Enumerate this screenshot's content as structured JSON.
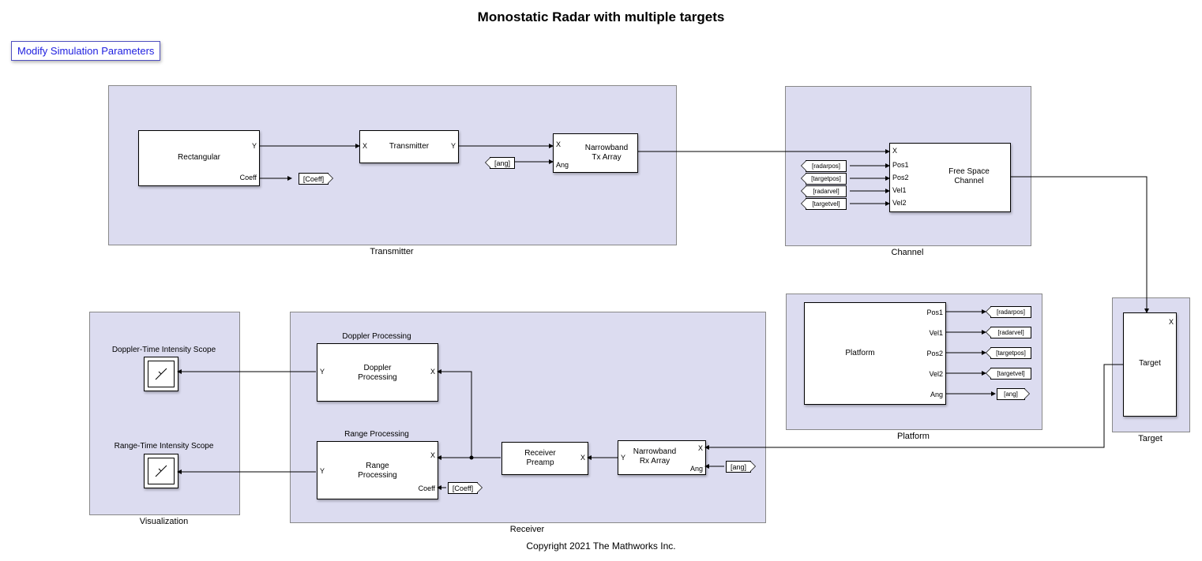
{
  "title": "Monostatic Radar with multiple targets",
  "link": "Modify Simulation Parameters",
  "footer": "Copyright 2021 The Mathworks Inc.",
  "groups": {
    "transmitter": "Transmitter",
    "channel": "Channel",
    "platform": "Platform",
    "target": "Target",
    "receiver": "Receiver",
    "viz": "Visualization"
  },
  "blocks": {
    "rect": {
      "name": "Rectangular",
      "ports_out": [
        "Y",
        "Coeff"
      ]
    },
    "tx": {
      "name": "Transmitter",
      "ports_in": [
        "X"
      ],
      "ports_out": [
        "Y"
      ]
    },
    "txarray": {
      "name": "Narrowband\nTx Array",
      "ports_in": [
        "X",
        "Ang"
      ]
    },
    "fspace": {
      "name": "Free Space\nChannel",
      "ports_in": [
        "X",
        "Pos1",
        "Pos2",
        "Vel1",
        "Vel2"
      ]
    },
    "platform": {
      "name": "Platform",
      "ports_out": [
        "Pos1",
        "Vel1",
        "Pos2",
        "Vel2",
        "Ang"
      ]
    },
    "target": {
      "name": "Target",
      "ports_in": [
        "X"
      ]
    },
    "rxarray": {
      "name": "Narrowband\nRx Array",
      "ports_in_r": [
        "X",
        "Ang"
      ],
      "ports_out": [
        "Y"
      ]
    },
    "preamp": {
      "name": "Receiver\nPreamp",
      "ports_in_r": [
        "X"
      ]
    },
    "range": {
      "name": "Range\nProcessing",
      "label": "Range Processing",
      "ports_in_r": [
        "X",
        "Coeff"
      ],
      "ports_out_l": [
        "Y"
      ]
    },
    "doppler": {
      "name": "Doppler\nProcessing",
      "label": "Doppler Processing",
      "ports_in_r": [
        "X"
      ],
      "ports_out_l": [
        "Y"
      ]
    },
    "scope1": "Doppler-Time Intensity Scope",
    "scope2": "Range-Time Intensity Scope"
  },
  "tags": {
    "coeff": "[Coeff]",
    "ang": "[ang]",
    "radarpos": "[radarpos]",
    "targetpos": "[targetpos]",
    "radarvel": "[radarvel]",
    "targetvel": "[targetvel]"
  }
}
